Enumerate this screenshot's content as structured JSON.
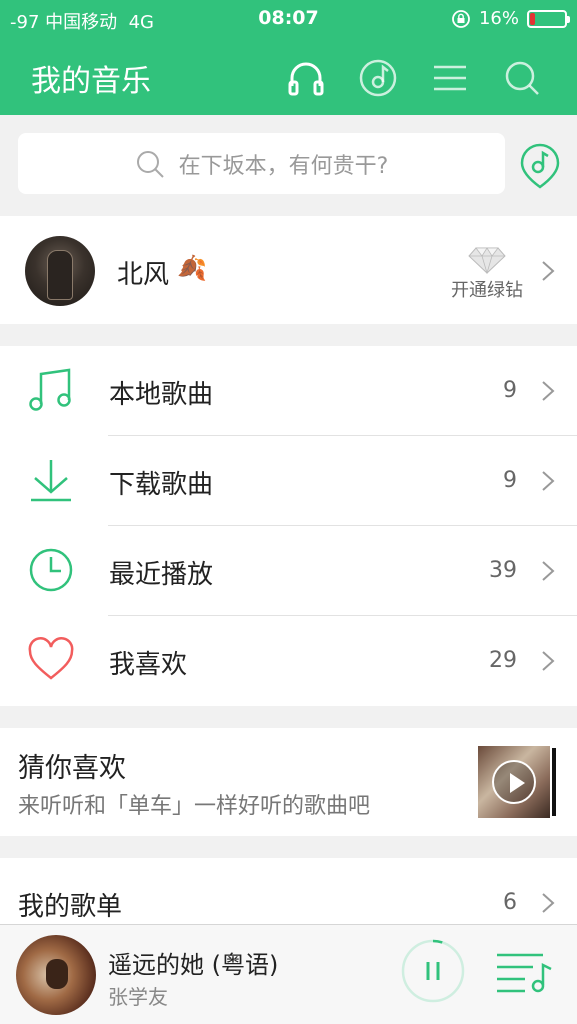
{
  "status": {
    "signal": "-97",
    "carrier": "中国移动",
    "network": "4G",
    "time": "08:07",
    "battery": "16%",
    "battery_level": 0.16,
    "battery_color": "#e33333"
  },
  "header": {
    "title": "我的音乐",
    "icons": [
      "headphones-icon",
      "radar-icon",
      "menu-icon",
      "search-icon"
    ]
  },
  "search": {
    "placeholder": "在下坂本，有何贵干?"
  },
  "profile": {
    "name": "北风",
    "name_emoji": "🍂",
    "vip_label": "开通绿钻"
  },
  "menu": {
    "items": [
      {
        "label": "本地歌曲",
        "count": "9",
        "icon": "music-note-icon"
      },
      {
        "label": "下载歌曲",
        "count": "9",
        "icon": "download-icon"
      },
      {
        "label": "最近播放",
        "count": "39",
        "icon": "clock-icon"
      },
      {
        "label": "我喜欢",
        "count": "29",
        "icon": "heart-icon"
      }
    ]
  },
  "guess": {
    "title": "猜你喜欢",
    "subtitle": "来听听和「单车」一样好听的歌曲吧"
  },
  "playlists": {
    "title": "我的歌单",
    "count": "6"
  },
  "player": {
    "song": "遥远的她 (粤语)",
    "artist": "张学友",
    "progress": 0.05
  },
  "colors": {
    "accent": "#31c27c",
    "heart": "#f25d5d"
  }
}
